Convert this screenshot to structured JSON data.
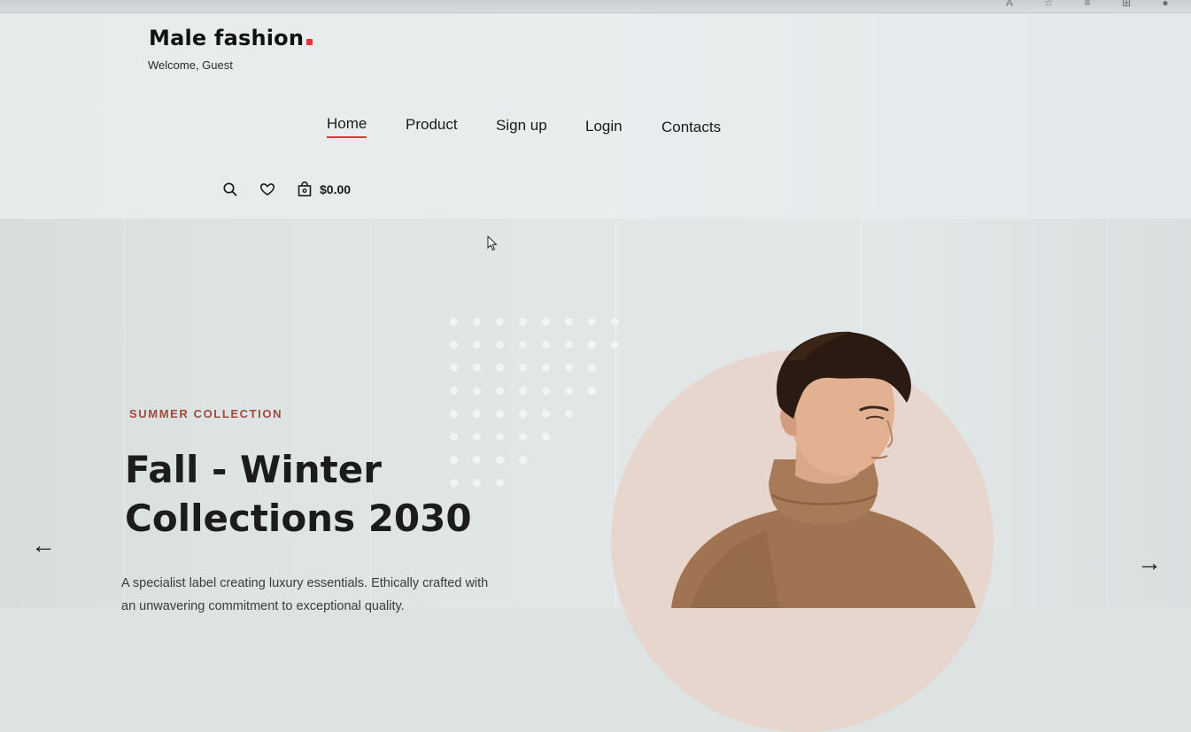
{
  "browser": {
    "toolbar_icons": [
      "reader-mode-icon",
      "favorites-icon",
      "collections-icon",
      "extensions-icon",
      "profile-icon"
    ]
  },
  "header": {
    "logo": "Male fashion",
    "logo_accent_color": "#e53637",
    "welcome": "Welcome, Guest",
    "nav": [
      {
        "label": "Home",
        "active": true
      },
      {
        "label": "Product",
        "active": false
      },
      {
        "label": "Sign up",
        "active": false
      },
      {
        "label": "Login",
        "active": false
      },
      {
        "label": "Contacts",
        "active": false
      }
    ],
    "cart_total": "$0.00"
  },
  "hero": {
    "eyebrow": "SUMMER COLLECTION",
    "title_line1": "Fall - Winter",
    "title_line2": "Collections 2030",
    "description": "A specialist label creating luxury essentials. Ethically crafted with an unwavering commitment to exceptional quality.",
    "prev_arrow": "←",
    "next_arrow": "→"
  }
}
